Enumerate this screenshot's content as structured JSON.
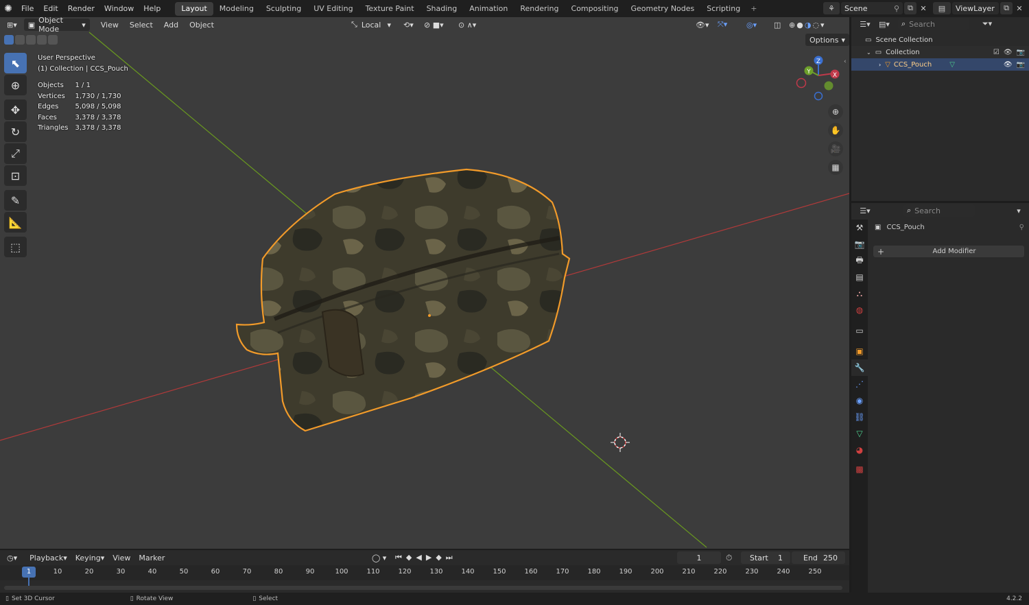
{
  "topbar": {
    "menu": [
      "File",
      "Edit",
      "Render",
      "Window",
      "Help"
    ],
    "workspaces": [
      "Layout",
      "Modeling",
      "Sculpting",
      "UV Editing",
      "Texture Paint",
      "Shading",
      "Animation",
      "Rendering",
      "Compositing",
      "Geometry Nodes",
      "Scripting"
    ],
    "active_workspace": "Layout",
    "scene": "Scene",
    "view_layer": "ViewLayer"
  },
  "viewport": {
    "mode": "Object Mode",
    "menu": [
      "View",
      "Select",
      "Add",
      "Object"
    ],
    "orientation": "Local",
    "options_label": "Options",
    "overlay": {
      "view_name": "User Perspective",
      "collection_line": "(1) Collection | CCS_Pouch",
      "stats": [
        {
          "label": "Objects",
          "value": "1 / 1"
        },
        {
          "label": "Vertices",
          "value": "1,730 / 1,730"
        },
        {
          "label": "Edges",
          "value": "5,098 / 5,098"
        },
        {
          "label": "Faces",
          "value": "3,378 / 3,378"
        },
        {
          "label": "Triangles",
          "value": "3,378 / 3,378"
        }
      ]
    },
    "gizmo": {
      "x": "X",
      "y": "Y",
      "z": "Z"
    },
    "colors": {
      "background": "#3c3c3c",
      "selection_outline": "#f29b2a",
      "x_axis": "#b23a3a",
      "y_axis": "#6a9a1f"
    }
  },
  "outliner": {
    "search_placeholder": "Search",
    "rows": [
      "Scene Collection",
      "Collection",
      "CCS_Pouch"
    ]
  },
  "properties": {
    "search_placeholder": "Search",
    "object_name": "CCS_Pouch",
    "add_modifier": "Add Modifier"
  },
  "timeline": {
    "menu": [
      "Playback",
      "Keying",
      "View",
      "Marker"
    ],
    "current_frame": "1",
    "start_label": "Start",
    "start_value": "1",
    "end_label": "End",
    "end_value": "250",
    "ticks": [
      "1",
      "10",
      "20",
      "30",
      "40",
      "50",
      "60",
      "70",
      "80",
      "90",
      "100",
      "110",
      "120",
      "130",
      "140",
      "150",
      "160",
      "170",
      "180",
      "190",
      "200",
      "210",
      "220",
      "230",
      "240",
      "250"
    ]
  },
  "statusbar": {
    "items": [
      "Set 3D Cursor",
      "Rotate View",
      "Select"
    ],
    "version": "4.2.2"
  }
}
